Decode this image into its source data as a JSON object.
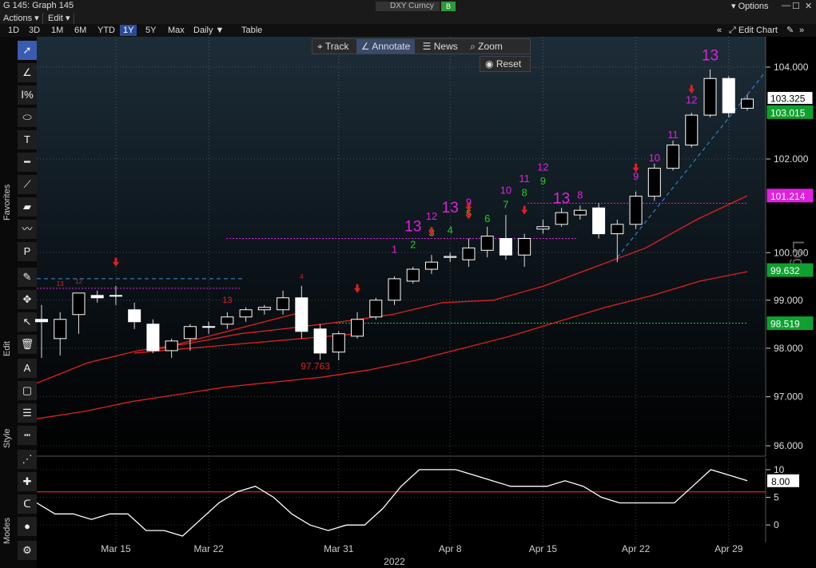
{
  "window": {
    "title": "G 145: Graph 145",
    "security": "DXY Curncy",
    "security_button": "B",
    "options_label": "Options"
  },
  "menus": [
    "Actions ▾",
    "Edit ▾"
  ],
  "ranges": [
    {
      "label": "1D",
      "active": false
    },
    {
      "label": "3D",
      "active": false
    },
    {
      "label": "1M",
      "active": false
    },
    {
      "label": "6M",
      "active": false
    },
    {
      "label": "YTD",
      "active": false
    },
    {
      "label": "1Y",
      "active": true
    },
    {
      "label": "5Y",
      "active": false
    },
    {
      "label": "Max",
      "active": false
    },
    {
      "label": "Daily ▼",
      "active": false
    },
    {
      "label": "Table",
      "active": false
    }
  ],
  "edit_chart_label": "Edit Chart",
  "overlay": {
    "track": "Track",
    "annotate": "Annotate",
    "news": "News",
    "zoom": "Zoom",
    "reset": "Reset"
  },
  "side_labels": {
    "favorites": "Favorites",
    "edit": "Edit",
    "style": "Style",
    "modes": "Modes"
  },
  "colors": {
    "up": "#ffffff",
    "ma_red": "#e02020",
    "trend": "#3a8fe0",
    "lbl_current": "#ffffff",
    "lbl_magenta": "#e020e0",
    "lbl_green": "#20d020"
  },
  "chart_data": [
    {
      "type": "candlestick",
      "scale": "log",
      "scale_label": "Log",
      "ylim": [
        96,
        104
      ],
      "yticks": [
        "104.000",
        "102.000",
        "100.000",
        "99.000",
        "98.000",
        "97.000",
        "96.000"
      ],
      "xticks": [
        "Mar 15",
        "Mar 22",
        "Mar 31",
        "Apr 8",
        "Apr 15",
        "Apr 22",
        "Apr 29"
      ],
      "xlabel": "2022",
      "candles": [
        [
          98.6,
          98.9,
          97.8,
          98.55
        ],
        [
          98.2,
          98.75,
          97.85,
          98.6
        ],
        [
          98.7,
          99.05,
          98.3,
          99.15
        ],
        [
          99.1,
          99.2,
          98.95,
          99.05
        ],
        [
          99.1,
          99.3,
          98.9,
          99.1
        ],
        [
          98.8,
          98.95,
          98.4,
          98.55
        ],
        [
          98.5,
          98.6,
          97.9,
          97.95
        ],
        [
          97.95,
          98.2,
          97.8,
          98.15
        ],
        [
          98.2,
          98.5,
          97.95,
          98.45
        ],
        [
          98.45,
          98.55,
          98.3,
          98.45
        ],
        [
          98.5,
          98.75,
          98.4,
          98.65
        ],
        [
          98.65,
          98.85,
          98.55,
          98.8
        ],
        [
          98.8,
          98.9,
          98.7,
          98.85
        ],
        [
          98.8,
          99.2,
          98.7,
          99.05
        ],
        [
          99.05,
          99.3,
          98.2,
          98.35
        ],
        [
          98.4,
          98.5,
          97.76,
          97.9
        ],
        [
          97.92,
          98.35,
          97.75,
          98.3
        ],
        [
          98.25,
          98.75,
          98.2,
          98.6
        ],
        [
          98.65,
          99.05,
          98.6,
          99.0
        ],
        [
          99.0,
          99.5,
          98.9,
          99.45
        ],
        [
          99.4,
          99.7,
          99.35,
          99.65
        ],
        [
          99.65,
          99.95,
          99.55,
          99.8
        ],
        [
          99.9,
          100.0,
          99.8,
          99.92
        ],
        [
          99.85,
          100.3,
          99.7,
          100.1
        ],
        [
          100.05,
          100.55,
          99.9,
          100.35
        ],
        [
          100.3,
          100.8,
          99.85,
          99.95
        ],
        [
          99.95,
          100.4,
          99.7,
          100.3
        ],
        [
          100.5,
          100.7,
          100.4,
          100.55
        ],
        [
          100.6,
          100.95,
          100.55,
          100.85
        ],
        [
          100.8,
          101.0,
          100.7,
          100.9
        ],
        [
          100.95,
          101.05,
          100.3,
          100.4
        ],
        [
          100.4,
          100.7,
          99.8,
          100.6
        ],
        [
          100.6,
          101.3,
          100.5,
          101.2
        ],
        [
          101.2,
          101.9,
          101.1,
          101.8
        ],
        [
          101.8,
          102.4,
          101.75,
          102.3
        ],
        [
          102.3,
          103.0,
          102.25,
          102.95
        ],
        [
          102.95,
          103.95,
          102.9,
          103.75
        ],
        [
          103.75,
          103.8,
          102.9,
          103.0
        ],
        [
          103.1,
          103.4,
          103.05,
          103.3
        ]
      ],
      "ma1": [
        97.28,
        97.7,
        97.95,
        98.1,
        98.3,
        98.42,
        98.55,
        98.7,
        98.95,
        99.0,
        99.3,
        99.7,
        100.1,
        100.7,
        101.21
      ],
      "ma2": [
        96.55,
        96.7,
        96.9,
        97.05,
        97.2,
        97.3,
        97.4,
        97.55,
        97.75,
        98.0,
        98.25,
        98.55,
        98.85,
        99.1,
        99.4,
        99.6
      ],
      "price_labels": [
        {
          "text": "103.325",
          "style": "current"
        },
        {
          "text": "103.015",
          "style": "green"
        },
        {
          "text": "101.214",
          "style": "magenta"
        },
        {
          "text": "99.632",
          "style": "green"
        },
        {
          "text": "98.519",
          "style": "green"
        }
      ],
      "low_label": "97.763",
      "counts": [
        {
          "text": "13",
          "bar": 10,
          "color": "red",
          "size": "s",
          "y": 98.95
        },
        {
          "text": "12",
          "bar": 2,
          "color": "red",
          "size": "xs",
          "y": 99.35
        },
        {
          "text": "13",
          "bar": 1,
          "color": "red",
          "size": "xs",
          "y": 99.3
        },
        {
          "text": "4",
          "bar": 14,
          "color": "red",
          "size": "xs",
          "y": 99.45
        },
        {
          "text": "1",
          "bar": 19,
          "color": "magenta",
          "size": "m",
          "y": 100.0
        },
        {
          "text": "13",
          "bar": 20,
          "color": "magenta",
          "size": "l",
          "y": 100.45
        },
        {
          "text": "2",
          "bar": 20,
          "color": "green",
          "size": "m",
          "y": 100.1
        },
        {
          "text": "12",
          "bar": 21,
          "color": "magenta",
          "size": "m",
          "y": 100.7
        },
        {
          "text": "3",
          "bar": 21,
          "color": "green",
          "size": "m",
          "y": 100.35
        },
        {
          "text": "13",
          "bar": 22,
          "color": "magenta",
          "size": "l",
          "y": 100.85
        },
        {
          "text": "4",
          "bar": 22,
          "color": "green",
          "size": "m",
          "y": 100.4
        },
        {
          "text": "9",
          "bar": 23,
          "color": "magenta",
          "size": "m",
          "y": 101.0
        },
        {
          "text": "5",
          "bar": 23,
          "color": "green",
          "size": "m",
          "y": 100.75
        },
        {
          "text": "6",
          "bar": 24,
          "color": "green",
          "size": "m",
          "y": 100.65
        },
        {
          "text": "10",
          "bar": 25,
          "color": "magenta",
          "size": "m",
          "y": 101.25
        },
        {
          "text": "7",
          "bar": 25,
          "color": "green",
          "size": "m",
          "y": 100.95
        },
        {
          "text": "11",
          "bar": 26,
          "color": "magenta",
          "size": "m",
          "y": 101.5
        },
        {
          "text": "8",
          "bar": 26,
          "color": "green",
          "size": "m",
          "y": 101.2
        },
        {
          "text": "12",
          "bar": 27,
          "color": "magenta",
          "size": "m",
          "y": 101.75
        },
        {
          "text": "9",
          "bar": 27,
          "color": "green",
          "size": "m",
          "y": 101.45
        },
        {
          "text": "13",
          "bar": 28,
          "color": "magenta",
          "size": "l",
          "y": 101.05
        },
        {
          "text": "8",
          "bar": 29,
          "color": "magenta",
          "size": "m",
          "y": 101.15
        },
        {
          "text": "9",
          "bar": 32,
          "color": "magenta",
          "size": "m",
          "y": 101.55
        },
        {
          "text": "10",
          "bar": 33,
          "color": "magenta",
          "size": "m",
          "y": 101.95
        },
        {
          "text": "11",
          "bar": 34,
          "color": "magenta",
          "size": "m",
          "y": 102.45
        },
        {
          "text": "12",
          "bar": 35,
          "color": "magenta",
          "size": "m",
          "y": 103.2
        },
        {
          "text": "13",
          "bar": 36,
          "color": "magenta",
          "size": "l",
          "y": 104.15
        }
      ],
      "arrows": [
        4,
        17,
        21,
        23,
        23,
        26,
        32,
        35
      ]
    },
    {
      "type": "line",
      "ylim": [
        -2,
        11
      ],
      "yticks": [
        "10",
        "5",
        "0"
      ],
      "reference_line": 6,
      "last_value": "8.00",
      "values": [
        4,
        2,
        2,
        1,
        2,
        2,
        -1,
        -1,
        -2,
        1,
        4,
        6,
        7,
        5,
        2,
        0,
        -1,
        0,
        0,
        3,
        7,
        10,
        10,
        10,
        9,
        8,
        7,
        7,
        7,
        8,
        7,
        5,
        4,
        4,
        4,
        4,
        7,
        10,
        9,
        8
      ]
    }
  ]
}
